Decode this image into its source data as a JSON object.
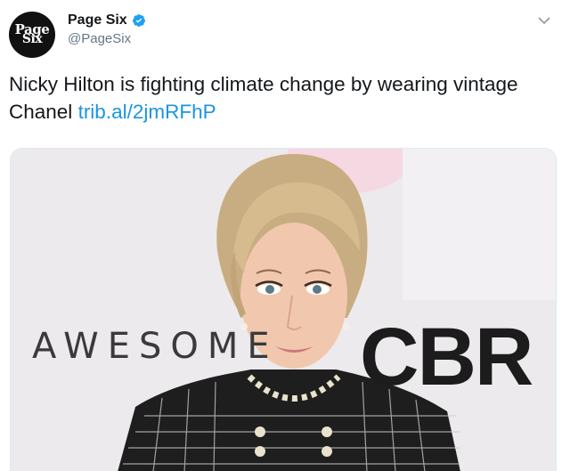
{
  "account": {
    "avatar_line1": "Page",
    "avatar_line2": "Six",
    "display_name": "Page Six",
    "handle": "@PageSix",
    "verified_icon": "verified-badge-icon"
  },
  "tweet": {
    "text": "Nicky Hilton is fighting climate change by wearing vintage Chanel ",
    "link": "trib.al/2jmRFhP"
  },
  "media": {
    "backdrop_word": "AWESOME",
    "backdrop_logo": "CBR"
  },
  "colors": {
    "link": "#1b95e0",
    "verified": "#1da1f2",
    "handle": "#657786"
  }
}
